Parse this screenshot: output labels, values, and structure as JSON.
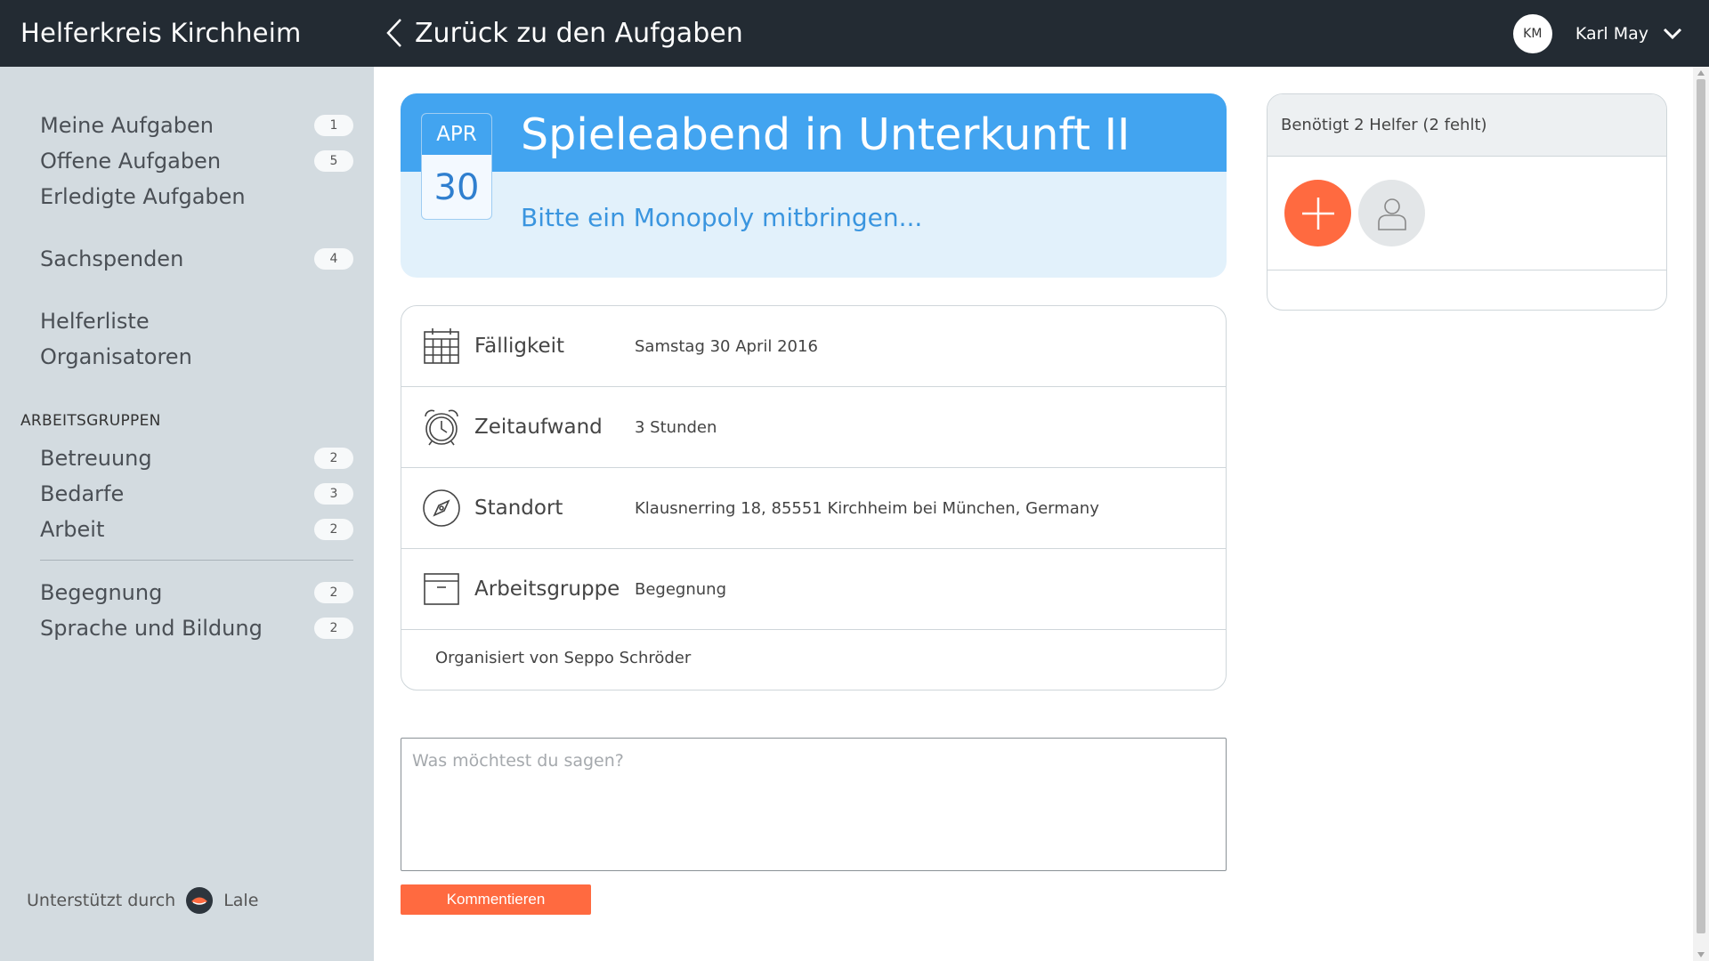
{
  "app": {
    "title": "Helferkreis Kirchheim"
  },
  "header": {
    "back_label": "Zurück zu den Aufgaben"
  },
  "user": {
    "initials": "KM",
    "name": "Karl May"
  },
  "sidebar": {
    "main_items": [
      {
        "label": "Meine Aufgaben",
        "count": "1"
      },
      {
        "label": "Offene Aufgaben",
        "count": "5"
      },
      {
        "label": "Erledigte Aufgaben",
        "count": ""
      },
      {
        "label": "Sachspenden",
        "count": "4"
      },
      {
        "label": "Helferliste",
        "count": ""
      },
      {
        "label": "Organisatoren",
        "count": ""
      }
    ],
    "section_title": "ARBEITSGRUPPEN",
    "group_items": [
      {
        "label": "Betreuung",
        "count": "2"
      },
      {
        "label": "Bedarfe",
        "count": "3"
      },
      {
        "label": "Arbeit",
        "count": "2"
      },
      {
        "label": "Begegnung",
        "count": "2"
      },
      {
        "label": "Sprache und Bildung",
        "count": "2"
      }
    ],
    "powered_by": "Unterstützt durch",
    "powered_brand": "Lale"
  },
  "task": {
    "month": "APR",
    "day": "30",
    "title": "Spieleabend in Unterkunft II",
    "subtitle": "Bitte ein Monopoly mitbringen..."
  },
  "details": [
    {
      "icon": "calendar-icon",
      "label": "Fälligkeit",
      "value": "Samstag 30 April 2016"
    },
    {
      "icon": "alarm-clock-icon",
      "label": "Zeitaufwand",
      "value": "3 Stunden"
    },
    {
      "icon": "compass-icon",
      "label": "Standort",
      "value": "Klausnerring 18, 85551 Kirchheim bei München, Germany"
    },
    {
      "icon": "archive-box-icon",
      "label": "Arbeitsgruppe",
      "value": "Begegnung"
    }
  ],
  "organized_by": "Organisiert von Seppo Schröder",
  "comment": {
    "placeholder": "Was möchtest du sagen?",
    "button_label": "Kommentieren"
  },
  "helpers": {
    "heading": "Benötigt 2 Helfer (2 fehlt)"
  },
  "colors": {
    "topbar": "#232b33",
    "sidebar": "#d3dbe0",
    "accent_blue": "#42a4f0",
    "accent_orange": "#ff6a40"
  }
}
